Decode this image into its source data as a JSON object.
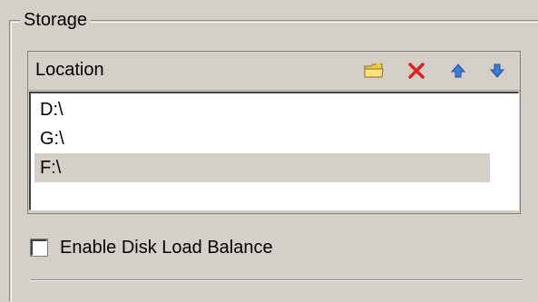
{
  "group": {
    "title": "Storage"
  },
  "location_panel": {
    "header_label": "Location",
    "toolbar": [
      {
        "icon": "folder-icon"
      },
      {
        "icon": "delete-icon"
      },
      {
        "icon": "arrow-up-icon"
      },
      {
        "icon": "arrow-down-icon"
      }
    ],
    "items": [
      "D:\\",
      "G:\\",
      "F:\\"
    ],
    "selected_index": 2
  },
  "options": {
    "enable_disk_load_balance_label": "Enable Disk Load Balance",
    "enable_disk_load_balance_checked": false
  },
  "colors": {
    "background": "#d4d0c8",
    "delete_red": "#e02020",
    "arrow_blue": "#3a7bdc",
    "folder_yellow": "#f2c94c"
  }
}
